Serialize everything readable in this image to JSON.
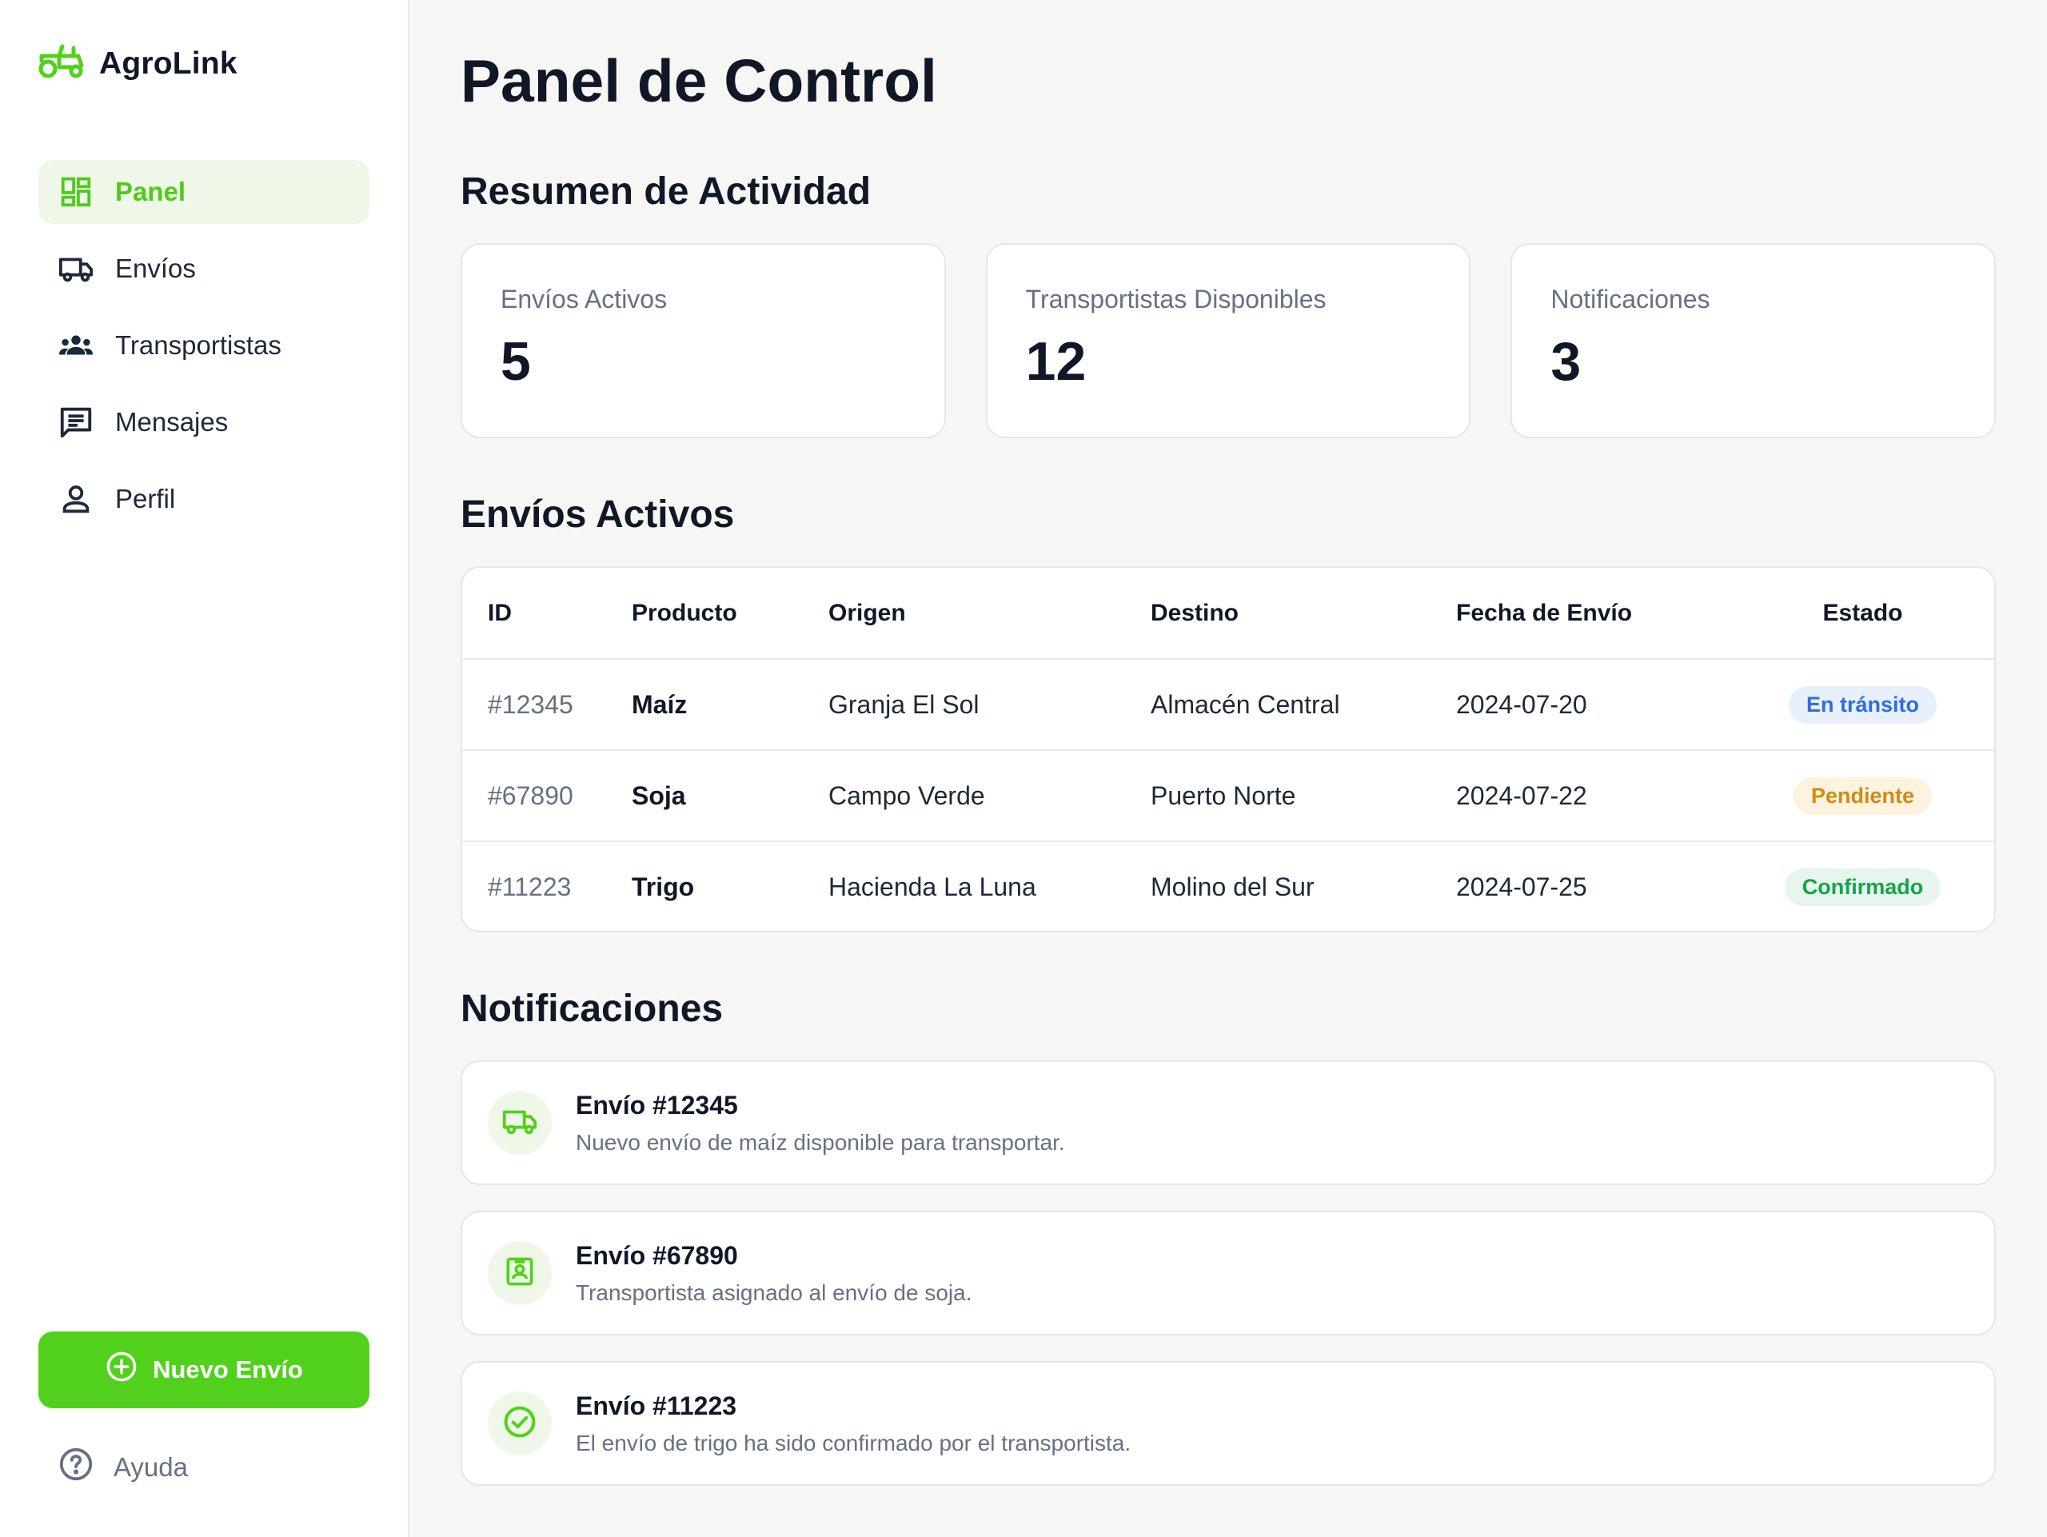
{
  "brand": {
    "name": "AgroLink",
    "icon": "tractor-icon",
    "accent": "#52d11c"
  },
  "sidebar": {
    "items": [
      {
        "label": "Panel",
        "icon": "dashboard-icon",
        "active": true
      },
      {
        "label": "Envíos",
        "icon": "truck-icon"
      },
      {
        "label": "Transportistas",
        "icon": "group-icon"
      },
      {
        "label": "Mensajes",
        "icon": "chat-icon"
      },
      {
        "label": "Perfil",
        "icon": "person-icon"
      }
    ],
    "new_button": "Nuevo Envío",
    "help": "Ayuda"
  },
  "main": {
    "title": "Panel de Control",
    "summary_title": "Resumen de Actividad",
    "cards": [
      {
        "label": "Envíos Activos",
        "value": "5"
      },
      {
        "label": "Transportistas Disponibles",
        "value": "12"
      },
      {
        "label": "Notificaciones",
        "value": "3"
      }
    ],
    "shipments_title": "Envíos Activos",
    "table": {
      "headers": [
        "ID",
        "Producto",
        "Origen",
        "Destino",
        "Fecha de Envío",
        "Estado"
      ],
      "rows": [
        {
          "id": "#12345",
          "product": "Maíz",
          "origin": "Granja El Sol",
          "destination": "Almacén Central",
          "date": "2024-07-20",
          "status": "En tránsito",
          "status_color": "#2e6de0"
        },
        {
          "id": "#67890",
          "product": "Soja",
          "origin": "Campo Verde",
          "destination": "Puerto Norte",
          "date": "2024-07-22",
          "status": "Pendiente",
          "status_color": "#d18a12"
        },
        {
          "id": "#11223",
          "product": "Trigo",
          "origin": "Hacienda La Luna",
          "destination": "Molino del Sur",
          "date": "2024-07-25",
          "status": "Confirmado",
          "status_color": "#16a34a"
        }
      ]
    },
    "notifications_title": "Notificaciones",
    "notifications": [
      {
        "title": "Envío #12345",
        "text": "Nuevo envío de maíz disponible para transportar.",
        "icon": "truck-icon"
      },
      {
        "title": "Envío #67890",
        "text": "Transportista asignado al envío de soja.",
        "icon": "badge-icon"
      },
      {
        "title": "Envío #11223",
        "text": "El envío de trigo ha sido confirmado por el transportista.",
        "icon": "check-circle-icon"
      }
    ]
  }
}
